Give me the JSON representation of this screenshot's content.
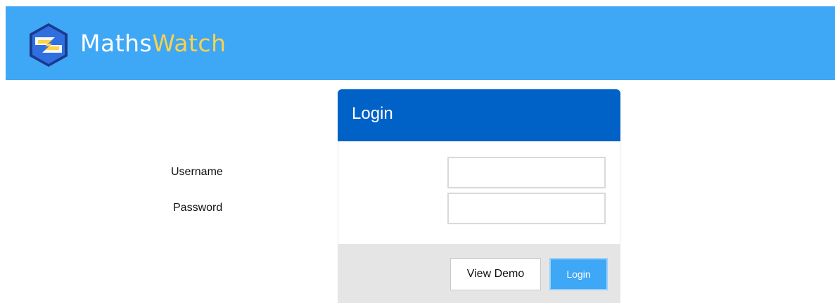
{
  "header": {
    "brand_part1": "Maths",
    "brand_part2": "Watch",
    "logo_icon": "mathswatch-logo-icon",
    "colors": {
      "bar": "#3ea7f6",
      "brand_accent": "#ffd24a"
    }
  },
  "login": {
    "title": "Login",
    "username_label": "Username",
    "password_label": "Password",
    "username_value": "",
    "password_value": "",
    "view_demo_label": "View Demo",
    "login_button_label": "Login",
    "colors": {
      "header": "#0061c7",
      "button": "#3ea7f6",
      "footer": "#e5e5e5"
    }
  }
}
